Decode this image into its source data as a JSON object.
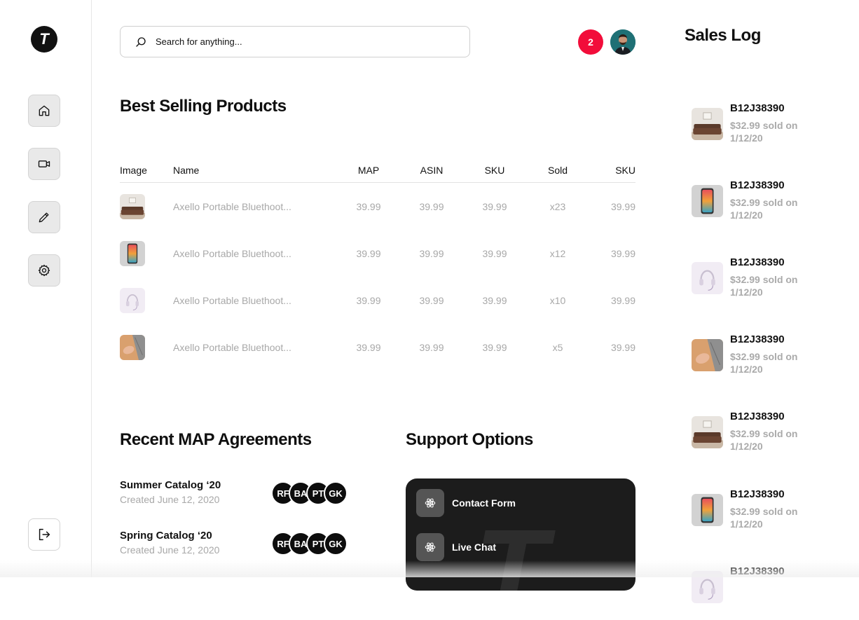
{
  "brand": {
    "logo_letter": "T"
  },
  "sidebar": {
    "items": [
      {
        "name": "home",
        "icon": "home-icon"
      },
      {
        "name": "video",
        "icon": "video-icon"
      },
      {
        "name": "edit",
        "icon": "pencil-icon"
      },
      {
        "name": "settings",
        "icon": "gear-icon"
      }
    ],
    "logout_icon": "logout-icon"
  },
  "header": {
    "search_placeholder": "Search for anything...",
    "notification_count": "2",
    "notification_color": "#f20d3a"
  },
  "best_selling": {
    "title": "Best Selling Products",
    "columns": [
      "Image",
      "Name",
      "MAP",
      "ASIN",
      "SKU",
      "Sold",
      "SKU"
    ],
    "rows": [
      {
        "image": "sofa",
        "name": "Axello Portable Bluethoot...",
        "map": "39.99",
        "asin": "39.99",
        "sku": "39.99",
        "sold": "x23",
        "sku2": "39.99"
      },
      {
        "image": "phone",
        "name": "Axello Portable Bluethoot...",
        "map": "39.99",
        "asin": "39.99",
        "sku": "39.99",
        "sold": "x12",
        "sku2": "39.99"
      },
      {
        "image": "headphones",
        "name": "Axello Portable Bluethoot...",
        "map": "39.99",
        "asin": "39.99",
        "sku": "39.99",
        "sold": "x10",
        "sku2": "39.99"
      },
      {
        "image": "laptop",
        "name": "Axello Portable Bluethoot...",
        "map": "39.99",
        "asin": "39.99",
        "sku": "39.99",
        "sold": "x5",
        "sku2": "39.99"
      }
    ]
  },
  "map_agreements": {
    "title": "Recent MAP Agreements",
    "items": [
      {
        "title": "Summer Catalog ‘20",
        "created": "Created June 12, 2020",
        "initials": [
          "RF",
          "BA",
          "PT",
          "GK"
        ]
      },
      {
        "title": "Spring Catalog ‘20",
        "created": "Created June 12, 2020",
        "initials": [
          "RF",
          "BA",
          "PT",
          "GK"
        ]
      }
    ]
  },
  "support": {
    "title": "Support Options",
    "items": [
      {
        "label": "Contact Form",
        "icon": "atom-icon"
      },
      {
        "label": "Live Chat",
        "icon": "atom-icon"
      }
    ]
  },
  "sales_log": {
    "title": "Sales Log",
    "items": [
      {
        "image": "sofa",
        "sku": "B12J38390",
        "meta": "$32.99 sold on 1/12/20"
      },
      {
        "image": "phone",
        "sku": "B12J38390",
        "meta": "$32.99 sold on 1/12/20"
      },
      {
        "image": "headphones",
        "sku": "B12J38390",
        "meta": "$32.99 sold on 1/12/20"
      },
      {
        "image": "laptop",
        "sku": "B12J38390",
        "meta": "$32.99 sold on 1/12/20"
      },
      {
        "image": "sofa",
        "sku": "B12J38390",
        "meta": "$32.99 sold on 1/12/20"
      },
      {
        "image": "phone",
        "sku": "B12J38390",
        "meta": "$32.99 sold on 1/12/20"
      },
      {
        "image": "headphones",
        "sku": "B12J38390",
        "meta": ""
      }
    ]
  }
}
